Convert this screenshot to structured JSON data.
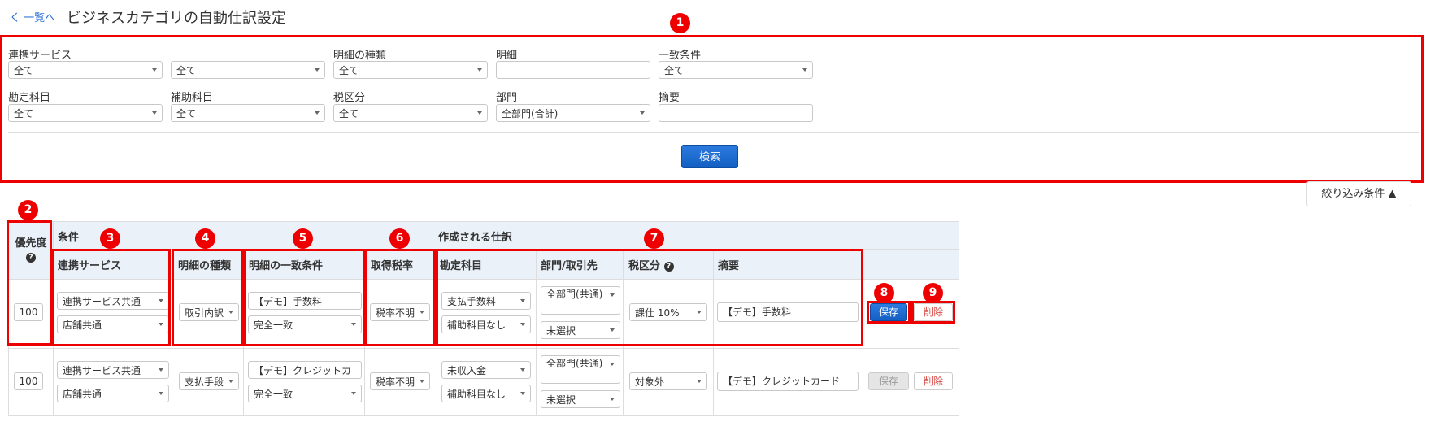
{
  "header": {
    "back_label": "く 一覧へ",
    "title": "ビジネスカテゴリの自動仕訳設定"
  },
  "callouts": [
    "1",
    "2",
    "3",
    "4",
    "5",
    "6",
    "7",
    "8",
    "9"
  ],
  "filters": {
    "service_label": "連携サービス",
    "service_value": "全て",
    "service2_value": "全て",
    "detail_type_label": "明細の種類",
    "detail_type_value": "全て",
    "detail_label": "明細",
    "detail_value": "",
    "match_label": "一致条件",
    "match_value": "全て",
    "account_label": "勘定科目",
    "account_value": "全て",
    "subaccount_label": "補助科目",
    "subaccount_value": "全て",
    "tax_label": "税区分",
    "tax_value": "全て",
    "dept_label": "部門",
    "dept_value": "全部門(合計)",
    "memo_label": "摘要",
    "memo_value": "",
    "search_button": "検索",
    "toggle_label": "絞り込み条件 ▲"
  },
  "table": {
    "priority_header": "優先度",
    "help_icon": "?",
    "condition_header": "条件",
    "created_header": "作成される仕訳",
    "columns": {
      "service": "連携サービス",
      "detail_type": "明細の種類",
      "match": "明細の一致条件",
      "tax_rate": "取得税率",
      "account": "勘定科目",
      "dept": "部門/取引先",
      "tax": "税区分",
      "memo": "摘要"
    },
    "rows": [
      {
        "priority": "100",
        "service": "連携サービス共通",
        "store": "店舗共通",
        "detail_type": "取引内訳",
        "match_text": "【デモ】手数料",
        "match_mode": "完全一致",
        "tax_rate": "税率不明",
        "account": "支払手数料",
        "subaccount": "補助科目なし",
        "dept": "全部門(共通)",
        "partner": "未選択",
        "tax": "課仕 10%",
        "memo": "【デモ】手数料",
        "save": "保存",
        "delete": "削除"
      },
      {
        "priority": "100",
        "service": "連携サービス共通",
        "store": "店舗共通",
        "detail_type": "支払手段",
        "match_text": "【デモ】クレジットカ",
        "match_mode": "完全一致",
        "tax_rate": "税率不明",
        "account": "未収入金",
        "subaccount": "補助科目なし",
        "dept": "全部門(共通)",
        "partner": "未選択",
        "tax": "対象外",
        "memo": "【デモ】クレジットカード",
        "save": "保存",
        "delete": "削除"
      }
    ]
  }
}
